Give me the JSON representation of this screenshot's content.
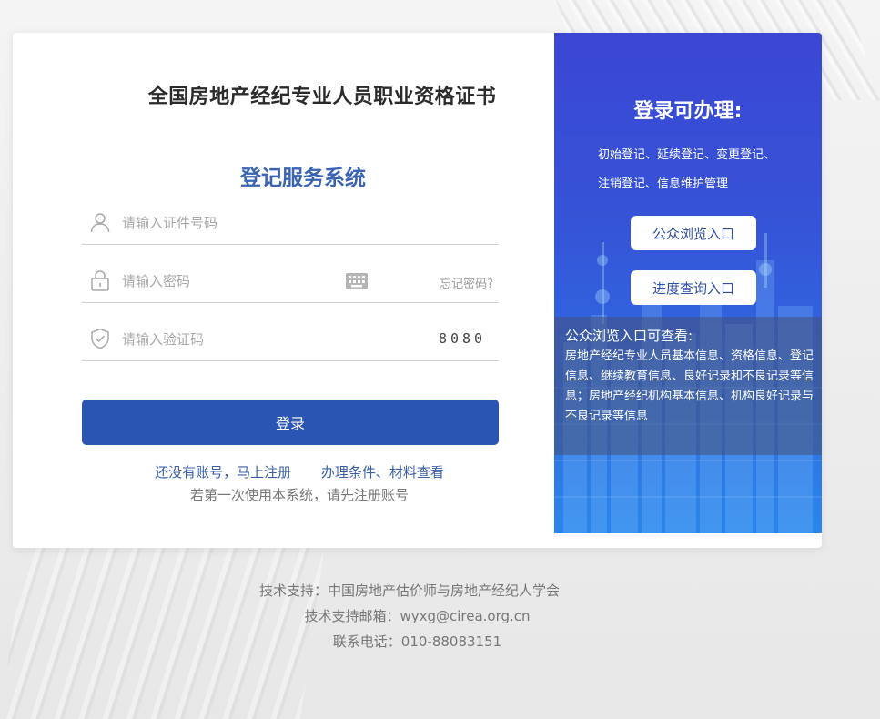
{
  "login": {
    "cert_title": "全国房地产经纪专业人员职业资格证书",
    "system_title": "登记服务系统",
    "id_placeholder": "请输入证件号码",
    "password_placeholder": "请输入密码",
    "forgot_password": "忘记密码?",
    "captcha_placeholder": "请输入验证码",
    "captcha_text": "8080",
    "login_button": "登录",
    "register_link": "还没有账号，马上注册",
    "conditions_link": "办理条件、材料查看",
    "first_use_hint": "若第一次使用本系统，请先注册账号"
  },
  "side": {
    "title": "登录可办理:",
    "services_line1": "初始登记、延续登记、变更登记、",
    "services_line2": "注销登记、信息维护管理",
    "public_browse_button": "公众浏览入口",
    "progress_query_button": "进度查询入口",
    "info_heading": "公众浏览入口可查看:",
    "info_text": "房地产经纪专业人员基本信息、资格信息、登记信息、继续教育信息、良好记录和不良记录等信息；房地产经纪机构基本信息、机构良好记录与不良记录等信息"
  },
  "footer": {
    "support": "技术支持：中国房地产估价师与房地产经纪人学会",
    "email": "技术支持邮箱：wyxg@cirea.org.cn",
    "phone": "联系电话：010-88083151"
  },
  "colors": {
    "primary_button": "#2a55b3",
    "system_title": "#3a63b4",
    "side_panel_top": "#3b47d4",
    "side_panel_bottom": "#2a86ea"
  },
  "icons": [
    "user-icon",
    "lock-icon",
    "keyboard-icon",
    "shield-check-icon"
  ]
}
